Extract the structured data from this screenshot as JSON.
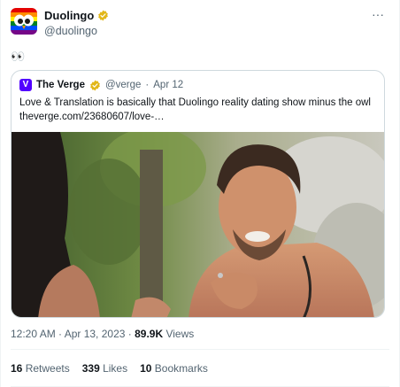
{
  "author": {
    "display_name": "Duolingo",
    "handle": "@duolingo",
    "verified_color": "#e2b719",
    "avatar_icon": "duolingo-owl-rainbow-avatar"
  },
  "tweet": {
    "text": "👀"
  },
  "quote": {
    "logo_letter": "V",
    "name": "The Verge",
    "handle": "@verge",
    "separator": "·",
    "date": "Apr 12",
    "text": "Love & Translation is basically that Duolingo reality dating show minus the owl",
    "link": "theverge.com/23680607/love-…",
    "brand_color": "#5200ff"
  },
  "meta": {
    "time": "12:20 AM · Apr 13, 2023 · ",
    "views_count": "89.9K",
    "views_label": " Views"
  },
  "stats": {
    "retweets_count": "16",
    "retweets_label": " Retweets",
    "likes_count": "339",
    "likes_label": " Likes",
    "bookmarks_count": "10",
    "bookmarks_label": " Bookmarks"
  },
  "icons": {
    "more": "more-horizontal-icon",
    "verified": "verified-badge-icon"
  }
}
